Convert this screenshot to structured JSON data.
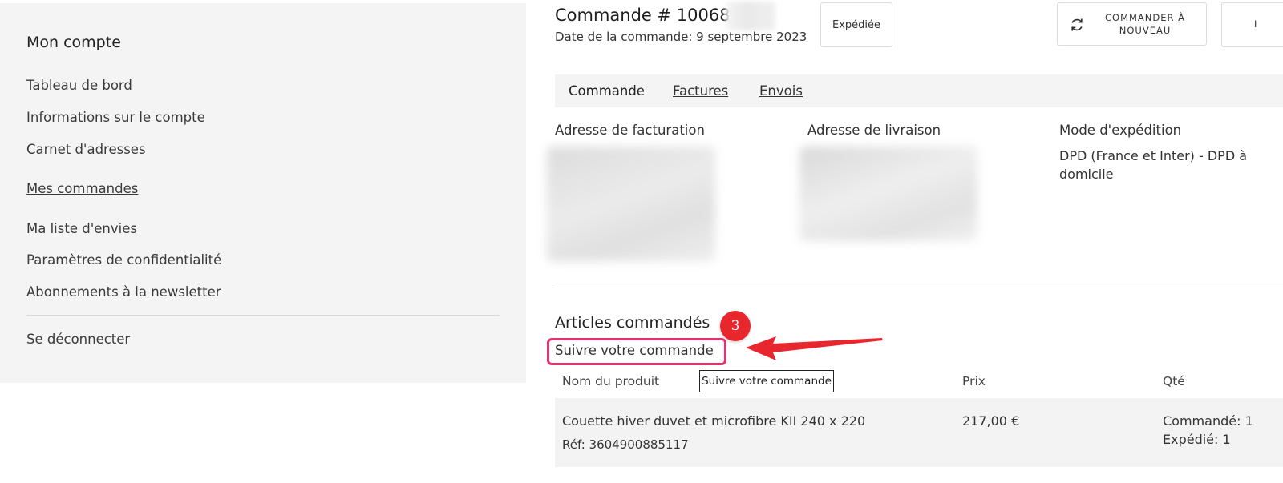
{
  "sidebar": {
    "title": "Mon compte",
    "items": [
      {
        "label": "Tableau de bord"
      },
      {
        "label": "Informations sur le compte"
      },
      {
        "label": "Carnet d'adresses"
      },
      {
        "label": "Mes commandes"
      },
      {
        "label": "Ma liste d'envies"
      },
      {
        "label": "Paramètres de confidentialité"
      },
      {
        "label": "Abonnements à la newsletter"
      }
    ],
    "logout": "Se déconnecter"
  },
  "order": {
    "title": "Commande # 100683",
    "date": "Date de la commande: 9 septembre 2023",
    "status": "Expédiée",
    "reorder_label": "COMMANDER À NOUVEAU",
    "print_label": "I"
  },
  "tabs": [
    {
      "label": "Commande"
    },
    {
      "label": "Factures"
    },
    {
      "label": "Envois"
    }
  ],
  "info": {
    "billing_heading": "Adresse de facturation",
    "shipping_heading": "Adresse de livraison",
    "method_heading": "Mode d'expédition",
    "method_value": "DPD (France et Inter) - DPD à domicile"
  },
  "items_section": {
    "title": "Articles commandés",
    "step_number": "3",
    "track_link": "Suivre votre commande",
    "tooltip": "Suivre votre commande",
    "columns": {
      "name": "Nom du produit",
      "price": "Prix",
      "qty": "Qté"
    },
    "rows": [
      {
        "name": "Couette hiver duvet et microfibre KII 240 x 220",
        "ref": "Réf: 3604900885117",
        "price": "217,00 €",
        "ordered": "Commandé: 1",
        "shipped": "Expédié: 1"
      }
    ]
  },
  "colors": {
    "sidebar_bg": "#f4f4f4",
    "annotation_red": "#e8262d",
    "highlight_pink": "#e2346a"
  },
  "icons": {
    "reorder": "refresh-icon",
    "arrow": "red-arrow-annotation"
  }
}
